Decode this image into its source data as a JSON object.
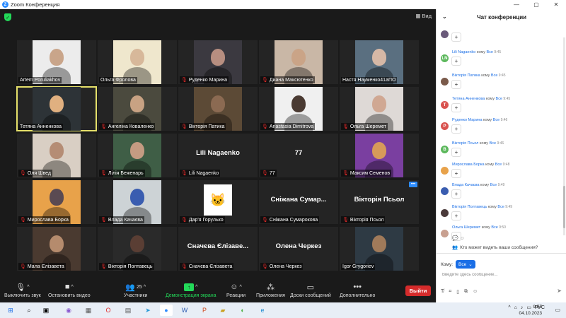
{
  "window": {
    "app_title": "Zoom Конференция",
    "controls": [
      "—",
      "▢",
      "✕"
    ]
  },
  "meeting": {
    "view_label": "Вид",
    "participants": [
      {
        "name": "Artem Poruliakhov",
        "muted": false,
        "type": "video",
        "bg": "#ececec",
        "skin": "#c9a58a"
      },
      {
        "name": "Ольга Фролова",
        "muted": false,
        "type": "video",
        "bg": "#efe7cd",
        "skin": "#d7b89a"
      },
      {
        "name": "Руденко Марина",
        "muted": true,
        "type": "video",
        "bg": "#3b3940",
        "skin": "#b78e80"
      },
      {
        "name": "Диана Максютенко",
        "muted": true,
        "type": "video",
        "bg": "#c9b7a6",
        "skin": "#caa487"
      },
      {
        "name": "Настя Науменко41аПО",
        "muted": false,
        "type": "video",
        "bg": "#5a6f80",
        "skin": "#d6b8a6"
      },
      {
        "name": "Тетяна Анненкова",
        "muted": false,
        "type": "video",
        "bg": "#2d3337",
        "skin": "#e0b080",
        "active": true
      },
      {
        "name": "Ангеліна Коваленко",
        "muted": true,
        "type": "video",
        "bg": "#4b4a3e",
        "skin": "#c8a283"
      },
      {
        "name": "Вікторія Патика",
        "muted": true,
        "type": "video",
        "bg": "#5c4a36",
        "skin": "#8b6a52"
      },
      {
        "name": "Anastasia Dimitrova",
        "muted": true,
        "type": "video",
        "bg": "#f0f0f0",
        "skin": "#4a3a32"
      },
      {
        "name": "Ольга Шеремет",
        "muted": true,
        "type": "video",
        "bg": "#ded9d6",
        "skin": "#d0a893"
      },
      {
        "name": "Оля Швед",
        "muted": true,
        "type": "video",
        "bg": "#d9cfc4",
        "skin": "#b58d75"
      },
      {
        "name": "Лілія Беженарь",
        "muted": true,
        "type": "video",
        "bg": "#3f5e46",
        "skin": "#c49b82"
      },
      {
        "name": "Lili Nagaenko",
        "muted": true,
        "type": "name",
        "display": "Lili Nagaenko"
      },
      {
        "name": "77",
        "muted": true,
        "type": "name",
        "display": "77"
      },
      {
        "name": "Максим Семенов",
        "muted": true,
        "type": "video",
        "bg": "#7a3fa0",
        "skin": "#d79a5a"
      },
      {
        "name": "Мирослава Борка",
        "muted": true,
        "type": "video",
        "bg": "#e8a24a",
        "skin": "#5a4a52"
      },
      {
        "name": "Влада Качаєва",
        "muted": true,
        "type": "video",
        "bg": "#cdd3d6",
        "skin": "#3a5db0"
      },
      {
        "name": "Дар'я Горулько",
        "muted": true,
        "type": "avatar"
      },
      {
        "name": "Сніжана Сумарокова",
        "muted": true,
        "type": "name",
        "display": "Сніжана Сумар..."
      },
      {
        "name": "Вікторія Псьол",
        "muted": true,
        "type": "name",
        "display": "Вікторія Псьол",
        "more": true
      },
      {
        "name": "Мала Єлізавета",
        "muted": true,
        "type": "video",
        "bg": "#4a3a30",
        "skin": "#b58b6d"
      },
      {
        "name": "Вікторія Полтавець",
        "muted": true,
        "type": "video",
        "bg": "#2a2a2a",
        "skin": "#5a3e34"
      },
      {
        "name": "Сначєва Єлізавета",
        "muted": true,
        "type": "name",
        "display": "Сначєва Єлізавe..."
      },
      {
        "name": "Олена Черкез",
        "muted": true,
        "type": "name",
        "display": "Олена Черкез"
      },
      {
        "name": "Igor Grygoriev",
        "muted": false,
        "type": "video",
        "bg": "#2e3a44",
        "skin": "#a07a5a"
      }
    ]
  },
  "toolbar": {
    "mute_label": "Выключить звук",
    "video_label": "Остановить видео",
    "participants_label": "Участники",
    "participants_count": "25",
    "share_label": "Демонстрация экрана",
    "reactions_label": "Реакции",
    "apps_label": "Приложения",
    "whiteboard_label": "Доски сообщений",
    "more_label": "Дополнительно",
    "leave_label": "Выйти"
  },
  "chat": {
    "title": "Чат конференции",
    "messages": [
      {
        "sender": "",
        "to": "",
        "time": "",
        "text": "+",
        "avatar_color": "#6a5a7a",
        "initials": ""
      },
      {
        "sender": "Lili Nagaenko",
        "to": "Все",
        "time": "9:45",
        "text": "+",
        "avatar_color": "#5cb85c",
        "initials": "LN"
      },
      {
        "sender": "Вікторія Патика",
        "to": "Все",
        "time": "9:45",
        "text": "+",
        "avatar_color": "#7a5a4a",
        "initials": ""
      },
      {
        "sender": "Тетяна Анненкова",
        "to": "Все",
        "time": "9:45",
        "text": "+",
        "avatar_color": "#d9534f",
        "initials": "Т"
      },
      {
        "sender": "Руденко Марина",
        "to": "Все",
        "time": "9:46",
        "text": "+",
        "avatar_color": "#d9534f",
        "initials": "Р"
      },
      {
        "sender": "Вікторія Псьол",
        "to": "Все",
        "time": "9:46",
        "text": "+",
        "avatar_color": "#5cb85c",
        "initials": "В"
      },
      {
        "sender": "Мирослава Борка",
        "to": "Все",
        "time": "9:48",
        "text": "+",
        "avatar_color": "#e8a24a",
        "initials": ""
      },
      {
        "sender": "Влада Качаєва",
        "to": "Все",
        "time": "9:49",
        "text": "+",
        "avatar_color": "#3a5db0",
        "initials": ""
      },
      {
        "sender": "Вікторія Полтавець",
        "to": "Все",
        "time": "9:49",
        "text": "+",
        "avatar_color": "#4a3a3a",
        "initials": ""
      },
      {
        "sender": "Ольга Шеремет",
        "to": "Все",
        "time": "9:50",
        "text": "+",
        "avatar_color": "#c8a090",
        "initials": ""
      }
    ],
    "to_word": "кому",
    "privacy_text": "Кто может видеть ваши сообщения?",
    "recipient_label": "Кому:",
    "recipient_value": "Все",
    "input_placeholder": "Введите здесь сообщение..."
  },
  "taskbar": {
    "language": "РУС",
    "time": "9:57",
    "date": "04.10.2023"
  }
}
